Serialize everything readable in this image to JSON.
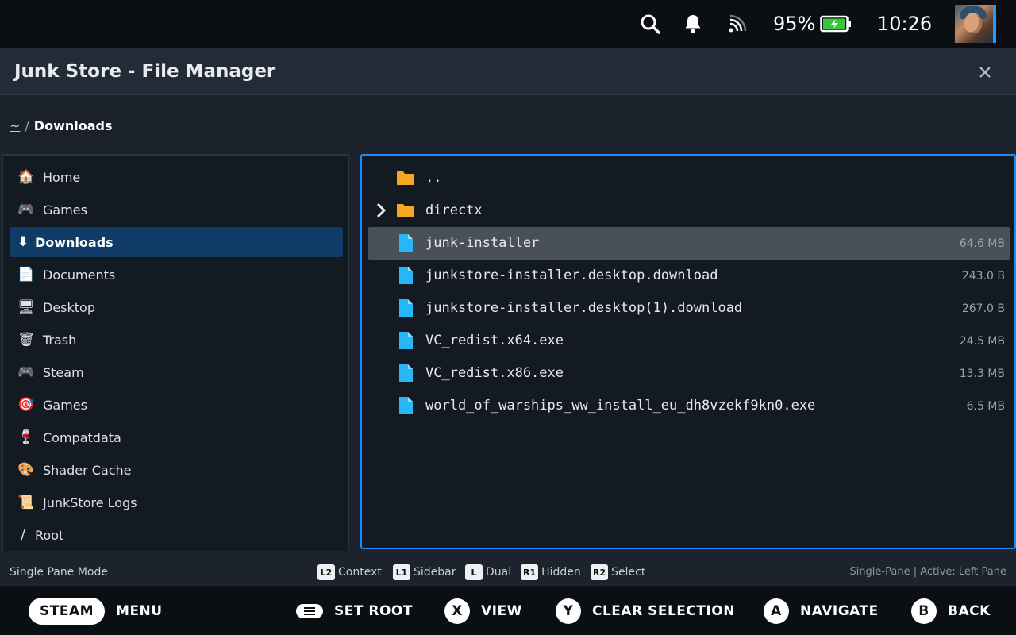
{
  "status_bar": {
    "battery_percent": "95%",
    "clock": "10:26",
    "icons": [
      "search-icon",
      "notification-bell-icon",
      "wifi-icon",
      "battery-charging-icon",
      "user-avatar"
    ]
  },
  "dialog": {
    "title": "Junk Store - File Manager",
    "close_icon": "close-icon"
  },
  "breadcrumb": {
    "home": "~",
    "separator": "/",
    "current": "Downloads"
  },
  "sidebar": {
    "items": [
      {
        "label": "Home",
        "icon": "house-icon",
        "glyph": "🏠"
      },
      {
        "label": "Games",
        "icon": "gamepad-icon",
        "glyph": "🎮"
      },
      {
        "label": "Downloads",
        "icon": "download-arrow-icon",
        "glyph": "⬇"
      },
      {
        "label": "Documents",
        "icon": "document-icon",
        "glyph": "📄"
      },
      {
        "label": "Desktop",
        "icon": "monitor-icon",
        "glyph": "🖥"
      },
      {
        "label": "Trash",
        "icon": "wastebasket-icon",
        "glyph": "🗑"
      },
      {
        "label": "Steam",
        "icon": "gamepad-icon",
        "glyph": "🎮"
      },
      {
        "label": "Games",
        "icon": "target-icon",
        "glyph": "🎯"
      },
      {
        "label": "Compatdata",
        "icon": "wine-glass-icon",
        "glyph": "🍷"
      },
      {
        "label": "Shader Cache",
        "icon": "palette-icon",
        "glyph": "🎨"
      },
      {
        "label": "JunkStore Logs",
        "icon": "scroll-icon",
        "glyph": "📜"
      },
      {
        "label": "Root",
        "icon": "slash-icon",
        "glyph": "/"
      }
    ],
    "active_index": 2
  },
  "files": {
    "rows": [
      {
        "name": "..",
        "size": "",
        "type": "folder",
        "expandable": false
      },
      {
        "name": "directx",
        "size": "",
        "type": "folder",
        "expandable": true
      },
      {
        "name": "junk-installer",
        "size": "64.6 MB",
        "type": "file",
        "expandable": false
      },
      {
        "name": "junkstore-installer.desktop.download",
        "size": "243.0 B",
        "type": "file",
        "expandable": false
      },
      {
        "name": "junkstore-installer.desktop(1).download",
        "size": "267.0 B",
        "type": "file",
        "expandable": false
      },
      {
        "name": "VC_redist.x64.exe",
        "size": "24.5 MB",
        "type": "file",
        "expandable": false
      },
      {
        "name": "VC_redist.x86.exe",
        "size": "13.3 MB",
        "type": "file",
        "expandable": false
      },
      {
        "name": "world_of_warships_ww_install_eu_dh8vzekf9kn0.exe",
        "size": "6.5 MB",
        "type": "file",
        "expandable": false
      }
    ],
    "selected_index": 2
  },
  "footer": {
    "mode": "Single Pane Mode",
    "hints": [
      {
        "key": "L2",
        "label": "Context"
      },
      {
        "key": "L1",
        "label": "Sidebar"
      },
      {
        "key": "L",
        "label": "Dual"
      },
      {
        "key": "R1",
        "label": "Hidden"
      },
      {
        "key": "R2",
        "label": "Select"
      }
    ],
    "pane_status": "Single-Pane | Active: Left Pane"
  },
  "button_bar": {
    "steam": {
      "badge": "STEAM",
      "label": "MENU"
    },
    "set_root": {
      "label": "SET ROOT"
    },
    "x": {
      "badge": "X",
      "label": "VIEW"
    },
    "y": {
      "badge": "Y",
      "label": "CLEAR SELECTION"
    },
    "a": {
      "badge": "A",
      "label": "NAVIGATE"
    },
    "b": {
      "badge": "B",
      "label": "BACK"
    }
  },
  "colors": {
    "accent": "#1a8cff",
    "folder": "#f5a623",
    "file": "#29b6f6",
    "sidebar_active": "#0f3b66",
    "row_selected": "#4a5058"
  }
}
